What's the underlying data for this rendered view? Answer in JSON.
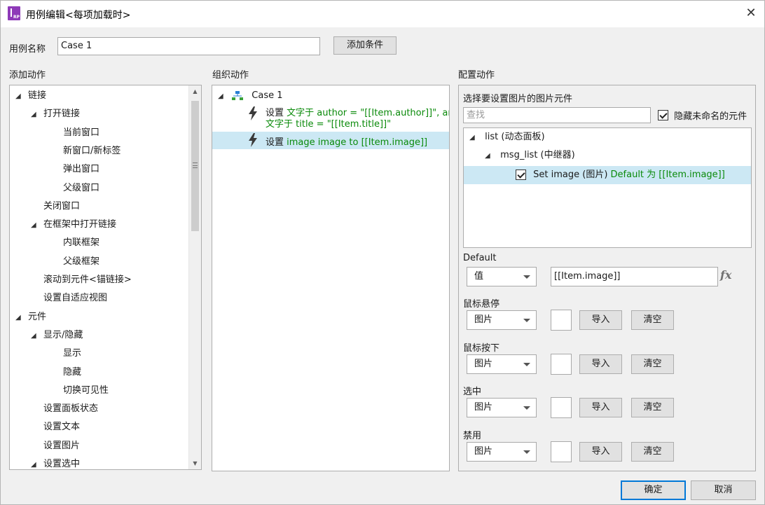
{
  "window": {
    "title": "用例编辑<每项加载时>",
    "close_glyph": "✕"
  },
  "case_name": {
    "label": "用例名称",
    "value": "Case 1",
    "add_condition": "添加条件"
  },
  "add_actions": {
    "title": "添加动作",
    "items": [
      {
        "label": "链接",
        "level": 0,
        "expander": "◢"
      },
      {
        "label": "打开链接",
        "level": 1,
        "expander": "◢"
      },
      {
        "label": "当前窗口",
        "level": 2
      },
      {
        "label": "新窗口/新标签",
        "level": 2
      },
      {
        "label": "弹出窗口",
        "level": 2
      },
      {
        "label": "父级窗口",
        "level": 2
      },
      {
        "label": "关闭窗口",
        "level": 1
      },
      {
        "label": "在框架中打开链接",
        "level": 1,
        "expander": "◢"
      },
      {
        "label": "内联框架",
        "level": 2
      },
      {
        "label": "父级框架",
        "level": 2
      },
      {
        "label": "滚动到元件<锚链接>",
        "level": 1
      },
      {
        "label": "设置自适应视图",
        "level": 1
      },
      {
        "label": "元件",
        "level": 0,
        "expander": "◢"
      },
      {
        "label": "显示/隐藏",
        "level": 1,
        "expander": "◢"
      },
      {
        "label": "显示",
        "level": 2
      },
      {
        "label": "隐藏",
        "level": 2
      },
      {
        "label": "切换可见性",
        "level": 2
      },
      {
        "label": "设置面板状态",
        "level": 1
      },
      {
        "label": "设置文本",
        "level": 1
      },
      {
        "label": "设置图片",
        "level": 1
      },
      {
        "label": "设置选中",
        "level": 1,
        "expander": "◢"
      }
    ],
    "scroll_up": "▲",
    "scroll_down": "▼"
  },
  "organize_actions": {
    "title": "组织动作",
    "case_expander": "◢",
    "case_label": "Case 1",
    "actions": [
      {
        "prefix": "设置",
        "line1": "文字于 author = \"[[Item.author]]\", and",
        "line2": "文字于 title = \"[[Item.title]]\""
      },
      {
        "prefix": "设置",
        "line1": "image image to [[Item.image]]"
      }
    ]
  },
  "configure_actions": {
    "title": "配置动作",
    "select_title": "选择要设置图片的图片元件",
    "search_placeholder": "查找",
    "hide_unnamed": "隐藏未命名的元件",
    "tree": [
      {
        "expander": "◢",
        "label": "list (动态面板)"
      },
      {
        "expander": "◢",
        "label": "msg_list (中继器)"
      },
      {
        "label": "Set image (图片)",
        "detail": "Default 为 [[Item.image]]"
      }
    ],
    "default_label": "Default",
    "default_type": "值",
    "default_value": "[[Item.image]]",
    "fx_label": "fx",
    "states": [
      {
        "label": "鼠标悬停",
        "type": "图片",
        "import": "导入",
        "clear": "清空"
      },
      {
        "label": "鼠标按下",
        "type": "图片",
        "import": "导入",
        "clear": "清空"
      },
      {
        "label": "选中",
        "type": "图片",
        "import": "导入",
        "clear": "清空"
      },
      {
        "label": "禁用",
        "type": "图片",
        "import": "导入",
        "clear": "清空"
      }
    ]
  },
  "footer": {
    "ok": "确定",
    "cancel": "取消"
  }
}
